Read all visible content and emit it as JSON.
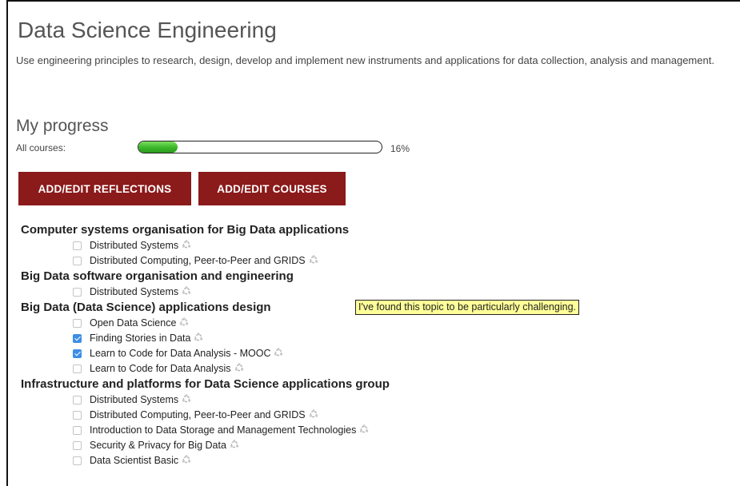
{
  "page": {
    "title": "Data Science Engineering",
    "description": "Use engineering principles to research, design, develop and implement new instruments and applications for data collection, analysis and management."
  },
  "progress": {
    "heading": "My progress",
    "label": "All courses:",
    "percent_text": "16%",
    "value_fraction": 0.16
  },
  "buttons": {
    "reflections": "ADD/EDIT REFLECTIONS",
    "courses": "ADD/EDIT COURSES"
  },
  "colors": {
    "button_bg": "#8b1a1a",
    "progress_fill": "#3eba2b",
    "checkbox_checked": "#3d8ee6",
    "tooltip_bg": "#ffff99"
  },
  "groups": [
    {
      "title": "Computer systems organisation for Big Data applications",
      "courses": [
        {
          "name": "Distributed Systems",
          "checked": false
        },
        {
          "name": "Distributed Computing, Peer-to-Peer and GRIDS",
          "checked": false
        }
      ]
    },
    {
      "title": "Big Data software organisation and engineering",
      "courses": [
        {
          "name": "Distributed Systems",
          "checked": false
        }
      ]
    },
    {
      "title": "Big Data (Data Science) applications design",
      "tooltip": "I've found this topic to be particularly challenging.",
      "courses": [
        {
          "name": "Open Data Science",
          "checked": false
        },
        {
          "name": "Finding Stories in Data",
          "checked": true
        },
        {
          "name": "Learn to Code for Data Analysis - MOOC",
          "checked": true
        },
        {
          "name": "Learn to Code for Data Analysis",
          "checked": false
        }
      ]
    },
    {
      "title": "Infrastructure and platforms for Data Science applications group",
      "courses": [
        {
          "name": "Distributed Systems",
          "checked": false
        },
        {
          "name": "Distributed Computing, Peer-to-Peer and GRIDS",
          "checked": false
        },
        {
          "name": "Introduction to Data Storage and Management Technologies",
          "checked": false
        },
        {
          "name": "Security & Privacy for Big Data",
          "checked": false
        },
        {
          "name": "Data Scientist Basic",
          "checked": false
        }
      ]
    }
  ],
  "icons": {
    "course_share": "share-icon"
  }
}
